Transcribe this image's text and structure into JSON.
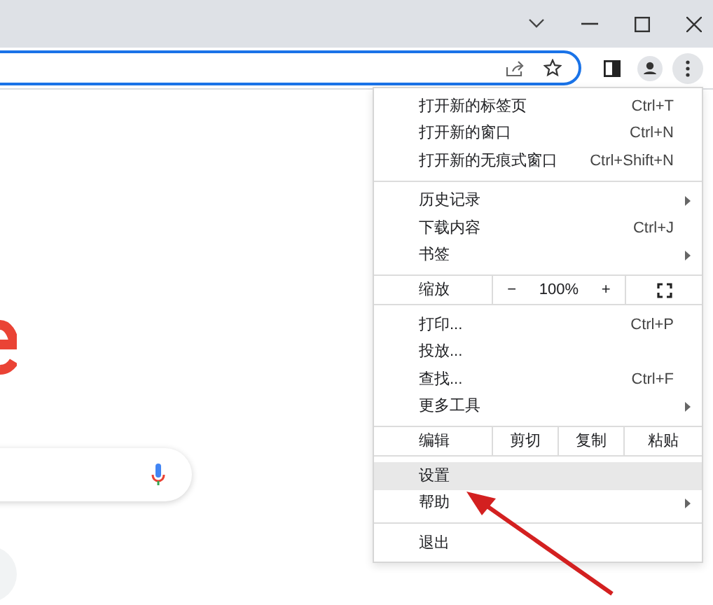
{
  "menu": {
    "sections": [
      {
        "items": [
          {
            "kind": "item",
            "label": "打开新的标签页",
            "shortcut": "Ctrl+T",
            "selected": false
          },
          {
            "kind": "item",
            "label": "打开新的窗口",
            "shortcut": "Ctrl+N",
            "selected": false
          },
          {
            "kind": "item",
            "label": "打开新的无痕式窗口",
            "shortcut": "Ctrl+Shift+N",
            "selected": false
          }
        ]
      },
      {
        "items": [
          {
            "kind": "submenu",
            "label": "历史记录",
            "selected": false
          },
          {
            "kind": "item",
            "label": "下载内容",
            "shortcut": "Ctrl+J",
            "selected": false
          },
          {
            "kind": "submenu",
            "label": "书签",
            "selected": false
          }
        ]
      },
      {
        "items": [
          {
            "kind": "zoom",
            "label": "缩放",
            "minus": "−",
            "value": "100%",
            "plus": "+"
          }
        ]
      },
      {
        "items": [
          {
            "kind": "item",
            "label": "打印...",
            "shortcut": "Ctrl+P",
            "selected": false
          },
          {
            "kind": "item",
            "label": "投放...",
            "selected": false
          },
          {
            "kind": "item",
            "label": "查找...",
            "shortcut": "Ctrl+F",
            "selected": false
          },
          {
            "kind": "submenu",
            "label": "更多工具",
            "selected": false
          }
        ]
      },
      {
        "items": [
          {
            "kind": "edit",
            "label": "编辑",
            "actions": [
              "剪切",
              "复制",
              "粘贴"
            ]
          }
        ]
      },
      {
        "items": [
          {
            "kind": "item",
            "label": "设置",
            "selected": true
          },
          {
            "kind": "submenu",
            "label": "帮助",
            "selected": false
          }
        ]
      },
      {
        "items": [
          {
            "kind": "item",
            "label": "退出",
            "selected": false
          }
        ]
      }
    ]
  }
}
